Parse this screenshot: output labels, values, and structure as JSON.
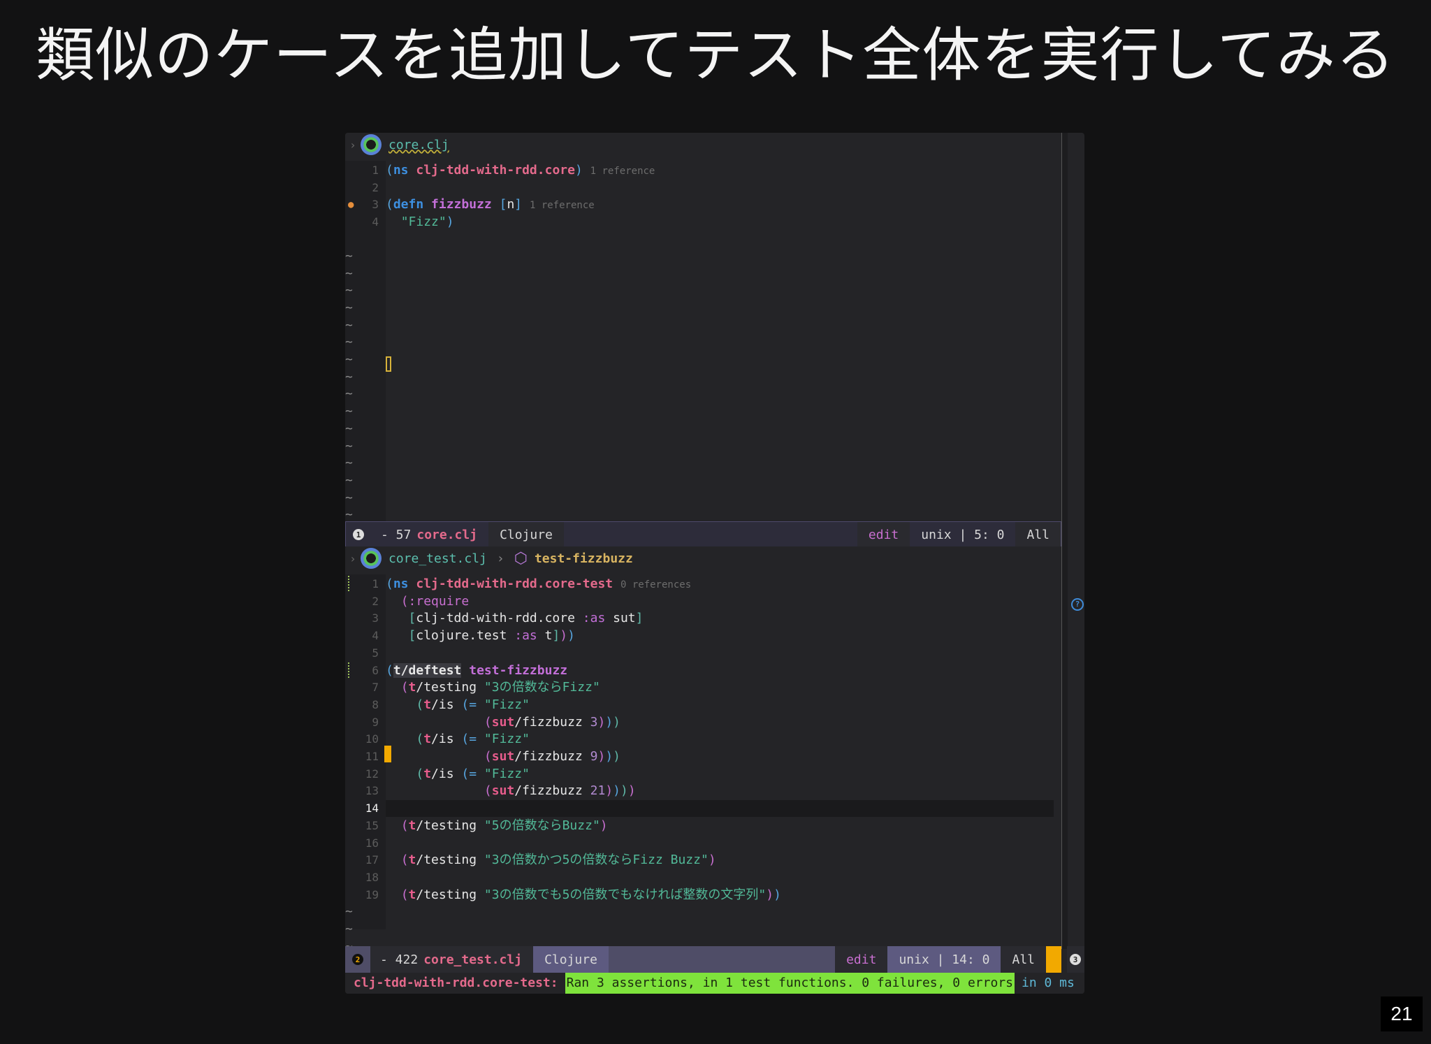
{
  "slide": {
    "title": "類似のケースを追加してテスト全体を実行してみる",
    "page_number": "21"
  },
  "pane1": {
    "file": "core.clj",
    "lines": [
      {
        "n": "1",
        "parts": [
          [
            "p",
            "("
          ],
          [
            "kw",
            "ns"
          ],
          [
            "t",
            " "
          ],
          [
            "ns",
            "clj-tdd-with-rdd.core"
          ],
          [
            "p",
            ")"
          ],
          [
            "t",
            " "
          ],
          [
            "ref",
            "1 reference"
          ]
        ]
      },
      {
        "n": "2",
        "parts": []
      },
      {
        "n": "3",
        "parts": [
          [
            "p",
            "("
          ],
          [
            "kw",
            "defn"
          ],
          [
            "t",
            " "
          ],
          [
            "fn",
            "fizzbuzz"
          ],
          [
            "t",
            " "
          ],
          [
            "p",
            "["
          ],
          [
            "tt",
            "n"
          ],
          [
            "p",
            "]"
          ],
          [
            "t",
            " "
          ],
          [
            "ref",
            "1 reference"
          ]
        ]
      },
      {
        "n": "4",
        "parts": [
          [
            "t",
            "  "
          ],
          [
            "str",
            "\"Fizz\""
          ],
          [
            "p",
            ")"
          ]
        ]
      }
    ],
    "tilde_count": 17,
    "status": {
      "badge": "1",
      "modified": "- 57",
      "filename": "core.clj",
      "lang": "Clojure",
      "mode": "edit",
      "info": "unix | 5: 0",
      "pos": "All"
    }
  },
  "pane2": {
    "file": "core_test.clj",
    "breadcrumb_fn": "test-fizzbuzz",
    "lines": [
      {
        "n": "1",
        "parts": [
          [
            "p",
            "("
          ],
          [
            "kw",
            "ns"
          ],
          [
            "t",
            " "
          ],
          [
            "ns",
            "clj-tdd-with-rdd.core-test"
          ],
          [
            "t",
            " "
          ],
          [
            "ref",
            "0 references"
          ]
        ]
      },
      {
        "n": "2",
        "parts": [
          [
            "t",
            "  "
          ],
          [
            "pk",
            "(:require"
          ]
        ]
      },
      {
        "n": "3",
        "parts": [
          [
            "t",
            "   "
          ],
          [
            "pg",
            "["
          ],
          [
            "tt",
            "clj-tdd-with-rdd.core "
          ],
          [
            "kwd",
            ":as"
          ],
          [
            "tt",
            " sut"
          ],
          [
            "pg",
            "]"
          ]
        ]
      },
      {
        "n": "4",
        "parts": [
          [
            "t",
            "   "
          ],
          [
            "pg",
            "["
          ],
          [
            "tt",
            "clojure.test "
          ],
          [
            "kwd",
            ":as"
          ],
          [
            "tt",
            " t"
          ],
          [
            "pg",
            "]"
          ],
          [
            "pk",
            ")"
          ],
          [
            "p",
            ")"
          ]
        ]
      },
      {
        "n": "5",
        "parts": []
      },
      {
        "n": "6",
        "parts": [
          [
            "p",
            "("
          ],
          [
            "hl",
            "t/deftest"
          ],
          [
            "t",
            " "
          ],
          [
            "fn",
            "test-fizzbuzz"
          ]
        ]
      },
      {
        "n": "7",
        "parts": [
          [
            "t",
            "  "
          ],
          [
            "pk",
            "("
          ],
          [
            "al",
            "t"
          ],
          [
            "tt",
            "/testing "
          ],
          [
            "str",
            "\"3の倍数ならFizz\""
          ]
        ]
      },
      {
        "n": "8",
        "parts": [
          [
            "t",
            "    "
          ],
          [
            "pg",
            "("
          ],
          [
            "al",
            "t"
          ],
          [
            "tt",
            "/is "
          ],
          [
            "p",
            "(= "
          ],
          [
            "str",
            "\"Fizz\""
          ]
        ]
      },
      {
        "n": "9",
        "parts": [
          [
            "t",
            "             "
          ],
          [
            "pk",
            "("
          ],
          [
            "al",
            "sut"
          ],
          [
            "tt",
            "/fizzbuzz "
          ],
          [
            "num",
            "3"
          ],
          [
            "pk",
            ")"
          ],
          [
            "p",
            ")"
          ],
          [
            "pg",
            ")"
          ]
        ]
      },
      {
        "n": "10",
        "parts": [
          [
            "t",
            "    "
          ],
          [
            "pg",
            "("
          ],
          [
            "al",
            "t"
          ],
          [
            "tt",
            "/is "
          ],
          [
            "p",
            "(= "
          ],
          [
            "str",
            "\"Fizz\""
          ]
        ]
      },
      {
        "n": "11",
        "parts": [
          [
            "t",
            "             "
          ],
          [
            "pk",
            "("
          ],
          [
            "al",
            "sut"
          ],
          [
            "tt",
            "/fizzbuzz "
          ],
          [
            "num",
            "9"
          ],
          [
            "pk",
            ")"
          ],
          [
            "p",
            ")"
          ],
          [
            "pg",
            ")"
          ]
        ]
      },
      {
        "n": "12",
        "parts": [
          [
            "t",
            "    "
          ],
          [
            "pg",
            "("
          ],
          [
            "al",
            "t"
          ],
          [
            "tt",
            "/is "
          ],
          [
            "p",
            "(= "
          ],
          [
            "str",
            "\"Fizz\""
          ]
        ]
      },
      {
        "n": "13",
        "parts": [
          [
            "t",
            "             "
          ],
          [
            "pk",
            "("
          ],
          [
            "al",
            "sut"
          ],
          [
            "tt",
            "/fizzbuzz "
          ],
          [
            "num",
            "21"
          ],
          [
            "pk",
            ")"
          ],
          [
            "p",
            ")"
          ],
          [
            "pg",
            ")"
          ],
          [
            "pk",
            ")"
          ]
        ]
      },
      {
        "n": "14",
        "parts": []
      },
      {
        "n": "15",
        "parts": [
          [
            "t",
            "  "
          ],
          [
            "pk",
            "("
          ],
          [
            "al",
            "t"
          ],
          [
            "tt",
            "/testing "
          ],
          [
            "str",
            "\"5の倍数ならBuzz\""
          ],
          [
            "pk",
            ")"
          ]
        ]
      },
      {
        "n": "16",
        "parts": []
      },
      {
        "n": "17",
        "parts": [
          [
            "t",
            "  "
          ],
          [
            "pk",
            "("
          ],
          [
            "al",
            "t"
          ],
          [
            "tt",
            "/testing "
          ],
          [
            "str",
            "\"3の倍数かつ5の倍数ならFizz Buzz\""
          ],
          [
            "pk",
            ")"
          ]
        ]
      },
      {
        "n": "18",
        "parts": []
      },
      {
        "n": "19",
        "parts": [
          [
            "t",
            "  "
          ],
          [
            "pk",
            "("
          ],
          [
            "al",
            "t"
          ],
          [
            "tt",
            "/testing "
          ],
          [
            "str",
            "\"3の倍数でも5の倍数でもなければ整数の文字列\""
          ],
          [
            "pk",
            ")"
          ],
          [
            "p",
            ")"
          ]
        ]
      }
    ],
    "tilde_count": 3,
    "status": {
      "badge": "2",
      "modified": "- 422",
      "filename": "core_test.clj",
      "lang": "Clojure",
      "mode": "edit",
      "info": "unix | 14: 0",
      "pos": "All",
      "right_badge": "3"
    }
  },
  "echo": {
    "namespace": "clj-tdd-with-rdd.core-test:",
    "result": "Ran 3 assertions, in 1 test functions. 0 failures, 0 errors",
    "timing": "in 0 ms"
  }
}
